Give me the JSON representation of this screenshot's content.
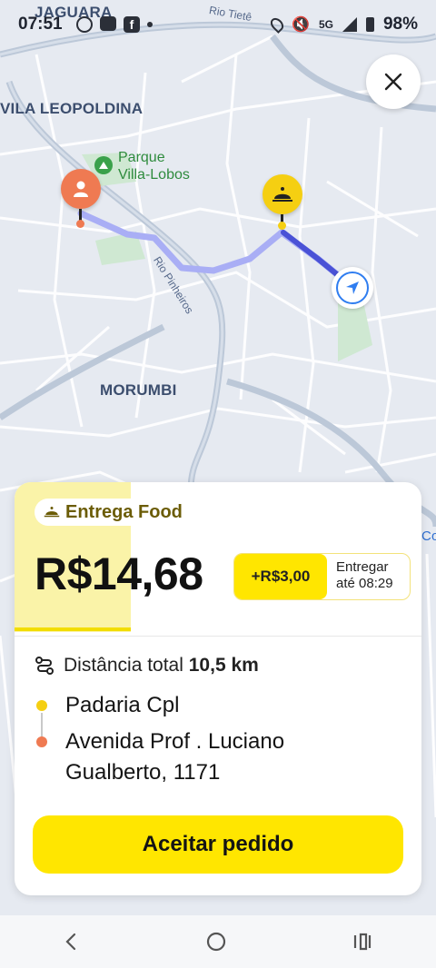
{
  "status_bar": {
    "time": "07:51",
    "signal_label": "5G",
    "battery": "98%"
  },
  "map": {
    "labels": {
      "jaguara": "JAGUARA",
      "vila_leopoldina": "VILA LEOPOLDINA",
      "morumbi": "MORUMBI",
      "park": "Parque\nVilla-Lobos",
      "rio_tiete": "Rio Tietê",
      "rio_pinheiros": "Rio Pinheiros",
      "edge": "Co"
    }
  },
  "card": {
    "order_type": "Entrega Food",
    "price": "R$14,68",
    "bonus": "+R$3,00",
    "deliver_line1": "Entregar",
    "deliver_line2": "até 08:29",
    "distance_label": "Distância total",
    "distance_value": "10,5 km",
    "pickup": "Padaria Cpl",
    "dropoff_line1": "Avenida Prof . Luciano",
    "dropoff_line2": "Gualberto, 1171",
    "accept_label": "Aceitar pedido"
  },
  "colors": {
    "accent_yellow": "#ffe600",
    "pickup_pin": "#f5cf12",
    "dropoff_pin": "#ef7a52",
    "route": "#a9aef5",
    "nav_blue": "#2f7df0"
  }
}
